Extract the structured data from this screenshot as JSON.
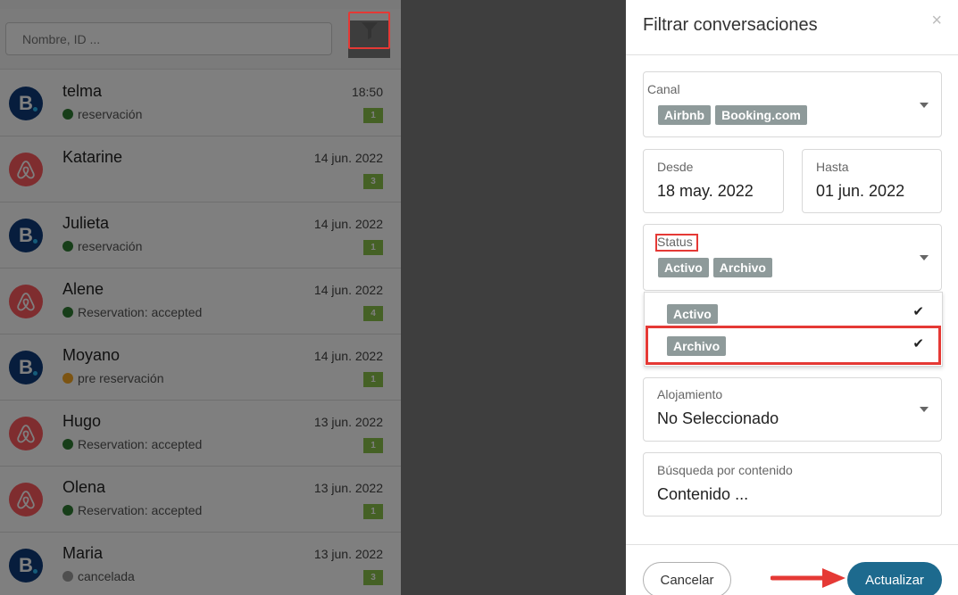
{
  "search": {
    "placeholder": "Nombre, ID ..."
  },
  "conversations": [
    {
      "name": "telma",
      "date": "18:50",
      "status": "reservación",
      "status_color": "#2e7d32",
      "count": "1",
      "channel": "booking"
    },
    {
      "name": "Katarine",
      "date": "14 jun. 2022",
      "status": "",
      "status_color": "",
      "count": "3",
      "channel": "airbnb"
    },
    {
      "name": "Julieta",
      "date": "14 jun. 2022",
      "status": "reservación",
      "status_color": "#2e7d32",
      "count": "1",
      "channel": "booking"
    },
    {
      "name": "Alene",
      "date": "14 jun. 2022",
      "status": "Reservation: accepted",
      "status_color": "#2e7d32",
      "count": "4",
      "channel": "airbnb"
    },
    {
      "name": "Moyano",
      "date": "14 jun. 2022",
      "status": "pre reservación",
      "status_color": "#f9a825",
      "count": "1",
      "channel": "booking"
    },
    {
      "name": "Hugo",
      "date": "13 jun. 2022",
      "status": "Reservation: accepted",
      "status_color": "#2e7d32",
      "count": "1",
      "channel": "airbnb"
    },
    {
      "name": "Olena",
      "date": "13 jun. 2022",
      "status": "Reservation: accepted",
      "status_color": "#2e7d32",
      "count": "1",
      "channel": "airbnb"
    },
    {
      "name": "Maria",
      "date": "13 jun. 2022",
      "status": "cancelada",
      "status_color": "#9e9e9e",
      "count": "3",
      "channel": "booking"
    }
  ],
  "booking_letter": "B",
  "panel": {
    "title": "Filtrar conversaciones",
    "close": "×",
    "canal": {
      "label": "Canal",
      "chips": [
        "Airbnb",
        "Booking.com"
      ]
    },
    "desde": {
      "label": "Desde",
      "value": "18 may. 2022"
    },
    "hasta": {
      "label": "Hasta",
      "value": "01 jun. 2022"
    },
    "status": {
      "label": "Status",
      "chips": [
        "Activo",
        "Archivo"
      ]
    },
    "status_options": [
      {
        "label": "Activo",
        "checked": "✔"
      },
      {
        "label": "Archivo",
        "checked": "✔"
      }
    ],
    "alojamiento": {
      "label": "Alojamiento",
      "value": "No Seleccionado"
    },
    "busqueda": {
      "label": "Búsqueda por contenido",
      "placeholder": "Contenido ..."
    },
    "cancel_label": "Cancelar",
    "update_label": "Actualizar"
  },
  "colors": {
    "highlight": "#e53935",
    "primary_button": "#1d6a8e",
    "chip": "#8e9a9a",
    "badge": "#8bc34a",
    "booking": "#0e3b7a",
    "airbnb": "#ff5a5f"
  },
  "icons": [
    "filter-icon",
    "close-icon",
    "chevron-down-icon",
    "check-icon",
    "booking-logo-icon",
    "airbnb-logo-icon",
    "arrow-right-icon"
  ]
}
